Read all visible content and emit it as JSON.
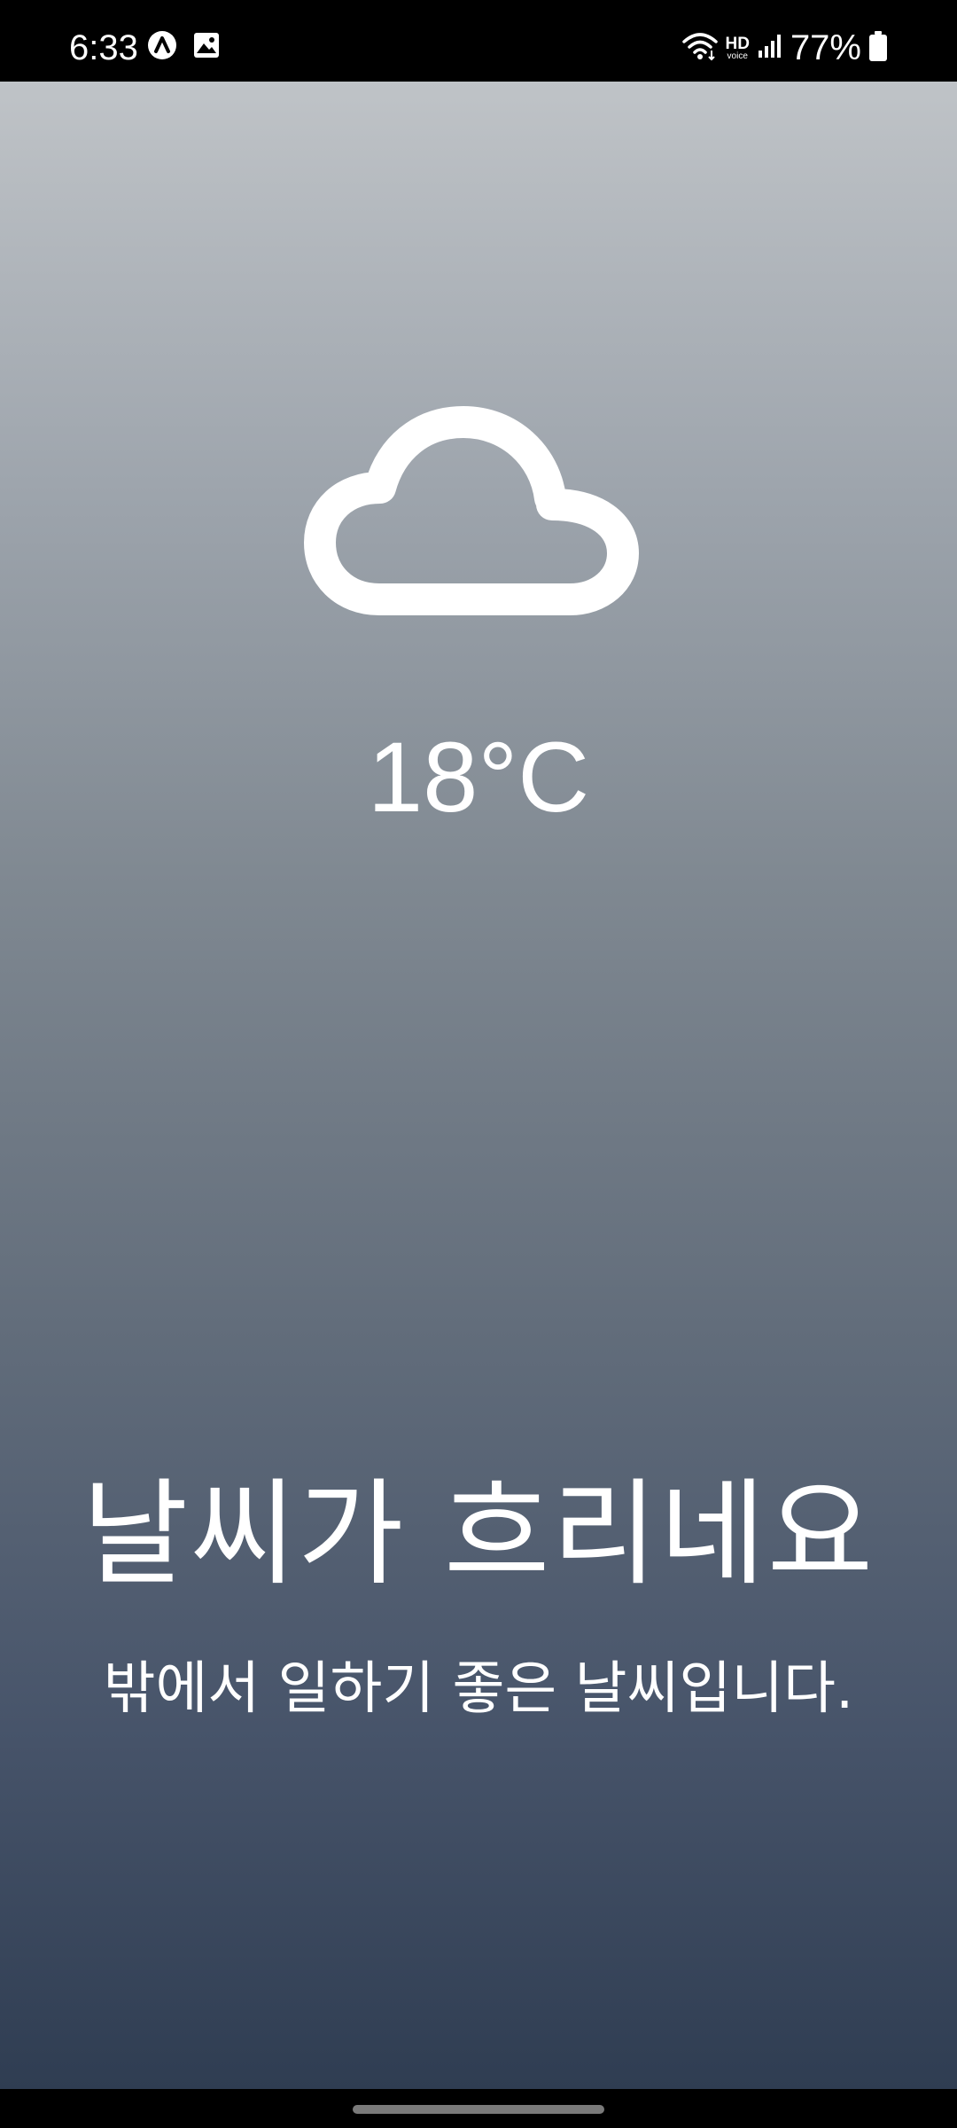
{
  "status_bar": {
    "time": "6:33",
    "left_icons": [
      "app-notification-icon",
      "gallery-icon"
    ],
    "right_icons": [
      "wifi-icon",
      "hd-voice-icon",
      "signal-icon",
      "battery-icon"
    ],
    "hd_label": "HD",
    "voice_label": "voice",
    "battery_percent": "77%"
  },
  "weather": {
    "icon": "cloud-icon",
    "temperature": "18°C",
    "headline": "날씨가 흐리네요",
    "message": "밖에서 일하기 좋은 날씨입니다.",
    "gradient_colors": [
      "#bfc3c7",
      "#9ea5ad",
      "#7f8891",
      "#626d7b",
      "#47546a",
      "#2f3d52"
    ]
  },
  "navigation": {
    "home_indicator": "home-indicator"
  }
}
